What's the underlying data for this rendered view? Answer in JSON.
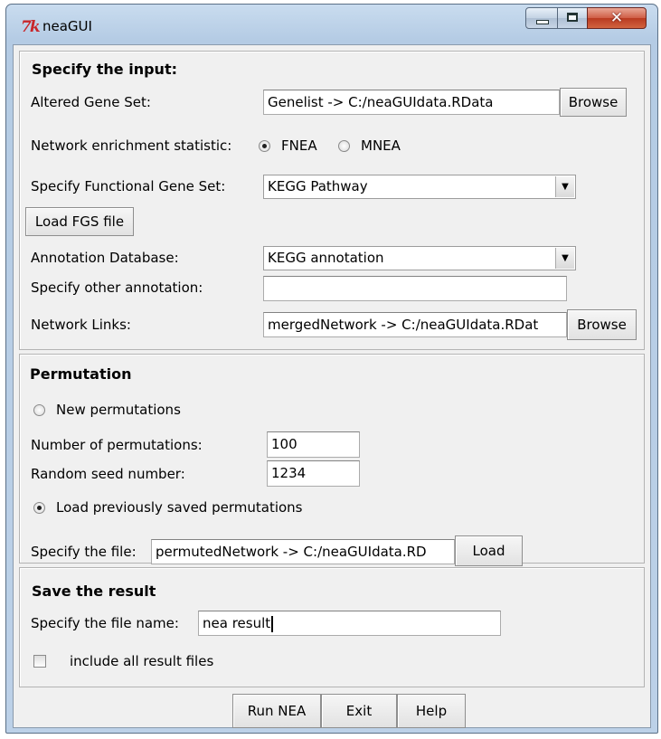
{
  "window": {
    "title": "neaGUI",
    "logo_text": "7k",
    "close_glyph": "✕",
    "icons": {
      "logo": "tk-feather-icon",
      "minimize": "minimize-icon",
      "maximize": "maximize-icon",
      "close": "close-icon"
    }
  },
  "input_section": {
    "heading": "Specify the input:",
    "altered_gene_set": {
      "label": "Altered Gene Set:",
      "value": "Genelist -> C:/neaGUIdata.RData",
      "browse_label": "Browse"
    },
    "statistic": {
      "label": "Network enrichment statistic:",
      "options": [
        {
          "label": "FNEA",
          "selected": true
        },
        {
          "label": "MNEA",
          "selected": false
        }
      ]
    },
    "functional_gene_set": {
      "label": "Specify Functional Gene Set:",
      "selected": "KEGG Pathway"
    },
    "load_fgs_button": "Load FGS file",
    "annotation_db": {
      "label": "Annotation Database:",
      "selected": "KEGG annotation"
    },
    "other_annotation": {
      "label": "Specify other annotation:",
      "value": ""
    },
    "network_links": {
      "label": "Network Links:",
      "value": "mergedNetwork -> C:/neaGUIdata.RDat",
      "browse_label": "Browse"
    }
  },
  "permutation_section": {
    "heading": "Permutation",
    "new_permutations": {
      "label": "New permutations",
      "selected": false
    },
    "num_permutations": {
      "label": "Number of permutations:",
      "value": "100"
    },
    "random_seed": {
      "label": "Random seed number:",
      "value": "1234"
    },
    "load_saved": {
      "label": "Load previously saved permutations",
      "selected": true
    },
    "file": {
      "label": "Specify the file:",
      "value": "permutedNetwork -> C:/neaGUIdata.RD",
      "load_label": "Load"
    }
  },
  "save_section": {
    "heading": "Save the result",
    "file_name": {
      "label": "Specify the file name:",
      "value": "nea result"
    },
    "include_all": {
      "label": "include all result files",
      "checked": false
    }
  },
  "footer": {
    "run_label": "Run NEA",
    "exit_label": "Exit",
    "help_label": "Help"
  }
}
